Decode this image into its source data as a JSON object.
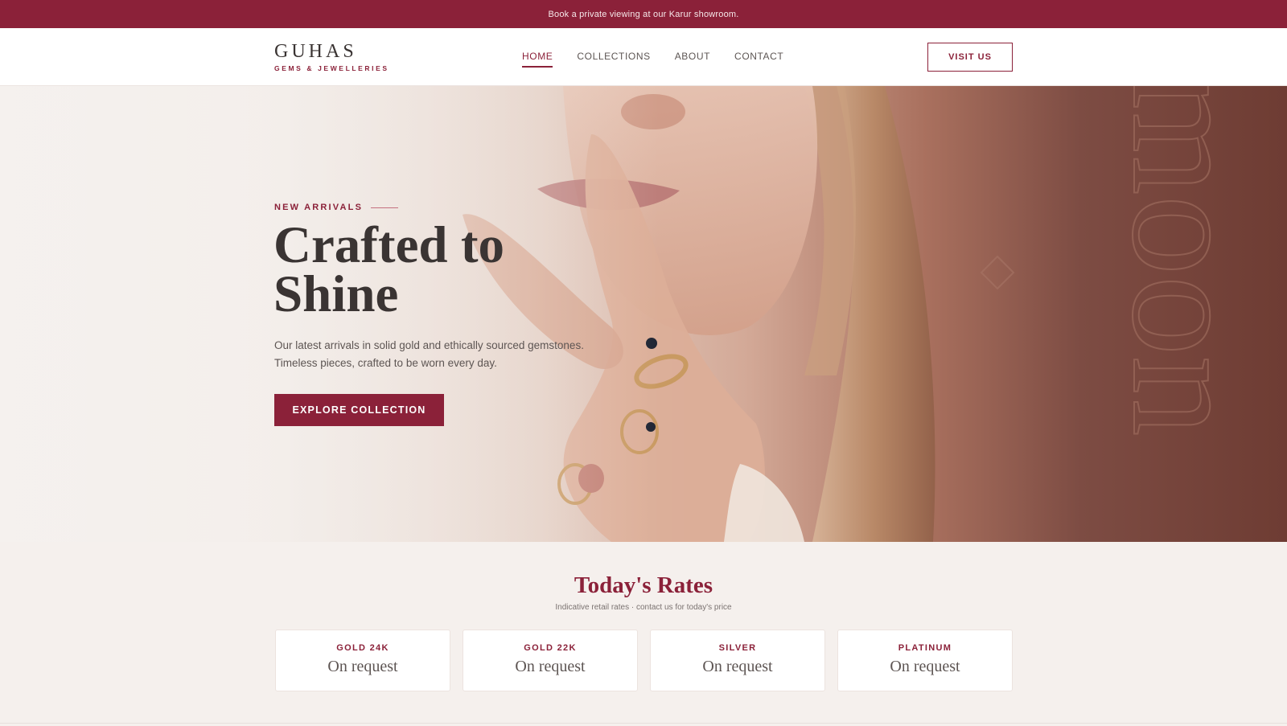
{
  "announcement": "Book a private viewing at our Karur showroom.",
  "brand": {
    "name": "GUHAS",
    "tagline": "GEMS & JEWELLERIES"
  },
  "nav": [
    {
      "label": "HOME",
      "active": true
    },
    {
      "label": "COLLECTIONS",
      "active": false
    },
    {
      "label": "ABOUT",
      "active": false
    },
    {
      "label": "CONTACT",
      "active": false
    }
  ],
  "header_cta": "VISIT US",
  "hero": {
    "eyebrow": "NEW ARRIVALS",
    "headline_line1": "Crafted to",
    "headline_line2": "Shine",
    "subtext_line1": "Our latest arrivals in solid gold and ethically sourced gemstones.",
    "subtext_line2": "Timeless pieces, crafted to be worn every day.",
    "cta": "EXPLORE COLLECTION",
    "watermark": "moon"
  },
  "rates": {
    "title": "Today's Rates",
    "subtitle": "Indicative retail rates · contact us for today's price",
    "cards": [
      {
        "label": "GOLD 24K",
        "value": "On request"
      },
      {
        "label": "GOLD 22K",
        "value": "On request"
      },
      {
        "label": "SILVER",
        "value": "On request"
      },
      {
        "label": "PLATINUM",
        "value": "On request"
      }
    ]
  },
  "colors": {
    "brand": "#8b2139",
    "text": "#3a3433",
    "background": "#f5f0ed",
    "hero_dark": "#6e3c33"
  }
}
